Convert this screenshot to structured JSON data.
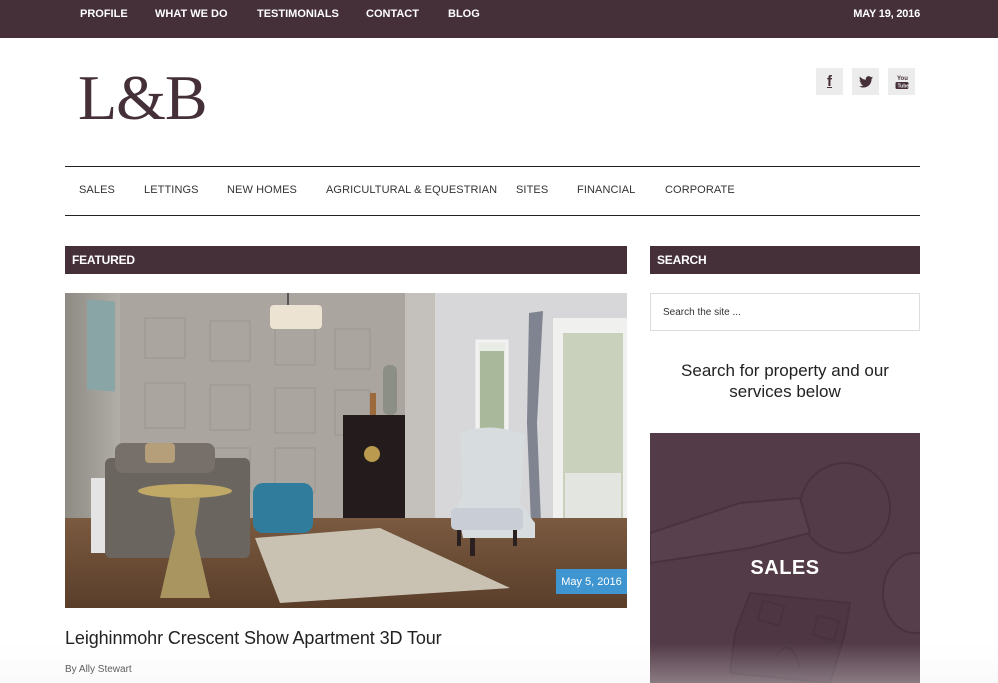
{
  "topbar": {
    "nav": [
      "PROFILE",
      "WHAT WE DO",
      "TESTIMONIALS",
      "CONTACT",
      "BLOG"
    ],
    "date": "MAY 19, 2016"
  },
  "brand": {
    "logo": "L&B",
    "color": "#45303a"
  },
  "social": [
    {
      "name": "facebook",
      "glyph": "f"
    },
    {
      "name": "twitter",
      "glyph": "twitter-bird"
    },
    {
      "name": "youtube",
      "glyph": "You Tube"
    }
  ],
  "mainnav": [
    "SALES",
    "LETTINGS",
    "NEW HOMES",
    "AGRICULTURAL & EQUESTRIAN",
    "SITES",
    "FINANCIAL",
    "CORPORATE"
  ],
  "featured": {
    "header": "FEATURED",
    "image_alt": "Living room show apartment interior",
    "date": "May 5, 2016",
    "title": "Leighinmohr Crescent Show Apartment 3D Tour",
    "byline": "By Ally Stewart",
    "badge_color": "#3f95d0"
  },
  "sidebar": {
    "search_header": "SEARCH",
    "search_placeholder": "Search the site ...",
    "tagline": "Search for property and our services below",
    "tile_label": "SALES"
  }
}
